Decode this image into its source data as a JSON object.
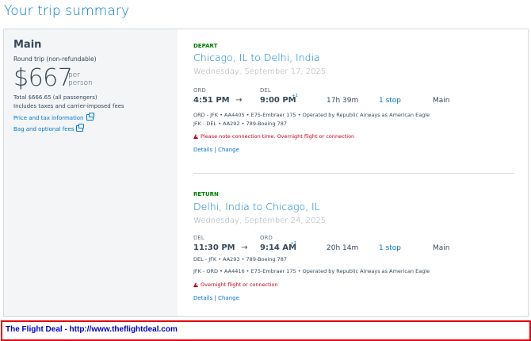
{
  "page": {
    "title": "Your trip summary"
  },
  "fare": {
    "name": "Main",
    "trip_type": "Round trip (non-refundable)",
    "price": "$667",
    "per_1": "per",
    "per_2": "person",
    "total": "Total $666.65 (all passengers)",
    "includes": "Includes taxes and carrier-imposed fees",
    "price_link": "Price and tax information",
    "bag_link": "Bag and optional fees"
  },
  "depart": {
    "label": "DEPART",
    "route": "Chicago, IL to Delhi, India",
    "date": "Wednesday, September 17, 2025",
    "from_code": "ORD",
    "to_code": "DEL",
    "dep_time": "4:51 PM",
    "arrow": "→",
    "arr_time": "9:00 PM",
    "day_offset": "+1",
    "duration": "17h 39m",
    "stops": "1 stop",
    "cabin": "Main",
    "legs": [
      "ORD - JFK • AA4405 • E75-Embraer 175 • Operated by Republic Airways as American Eagle",
      "JFK - DEL • AA292 • 789-Boeing 787"
    ],
    "warning": "Please note connection time. Overnight flight or connection",
    "details": "Details",
    "sep": "|",
    "change": "Change"
  },
  "return": {
    "label": "RETURN",
    "route": "Delhi, India to Chicago, IL",
    "date": "Wednesday, September 24, 2025",
    "from_code": "DEL",
    "to_code": "ORD",
    "dep_time": "11:30 PM",
    "arrow": "→",
    "arr_time": "9:14 AM",
    "day_offset": "+1",
    "duration": "20h 14m",
    "stops": "1 stop",
    "cabin": "Main",
    "legs": [
      "DEL - JFK • AA293 • 789-Boeing 787",
      "JFK - ORD • AA4416 • E75-Embraer 175 • Operated by Republic Airways as American Eagle"
    ],
    "warning": "Overnight flight or connection",
    "details": "Details",
    "sep": "|",
    "change": "Change"
  },
  "footer": {
    "text": "The Flight Deal - http://www.theflightdeal.com"
  },
  "colors": {
    "accent": "#0078d2",
    "green": "#008000",
    "warning": "#c30019",
    "footer_border": "#e8000b"
  }
}
